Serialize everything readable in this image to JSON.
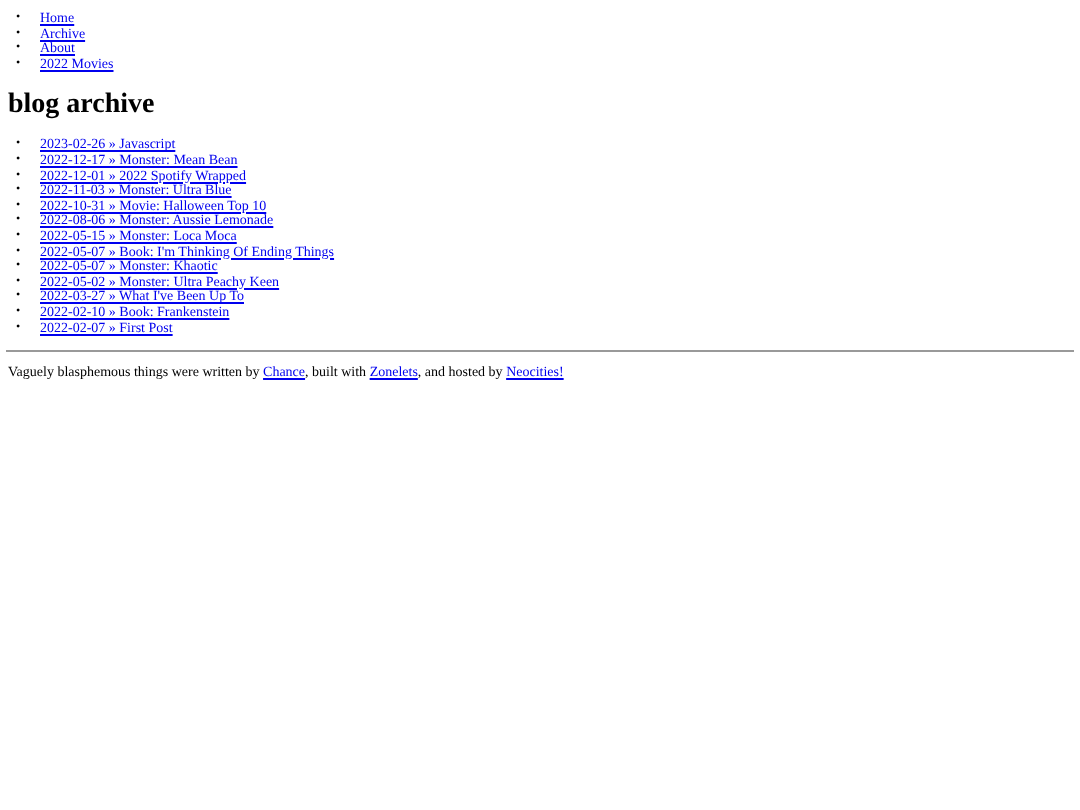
{
  "bullet": "•",
  "nav": [
    "Home",
    "Archive",
    "About",
    "2022 Movies"
  ],
  "heading": "blog archive",
  "posts": [
    "2023-02-26 » Javascript",
    "2022-12-17 » Monster: Mean Bean",
    "2022-12-01 » 2022 Spotify Wrapped",
    "2022-11-03 » Monster: Ultra Blue",
    "2022-10-31 » Movie: Halloween Top 10",
    "2022-08-06 » Monster: Aussie Lemonade",
    "2022-05-15 » Monster: Loca Moca",
    "2022-05-07 » Book: I'm Thinking Of Ending Things",
    "2022-05-07 » Monster: Khaotic",
    "2022-05-02 » Monster: Ultra Peachy Keen",
    "2022-03-27 » What I've Been Up To",
    "2022-02-10 » Book: Frankenstein",
    "2022-02-07 » First Post"
  ],
  "footer": [
    {
      "kind": "text",
      "text": "Vaguely blasphemous things were written by "
    },
    {
      "kind": "link",
      "text": "Chance"
    },
    {
      "kind": "text",
      "text": ", built with "
    },
    {
      "kind": "link",
      "text": "Zonelets"
    },
    {
      "kind": "text",
      "text": ", and hosted by "
    },
    {
      "kind": "link",
      "text": "Neocities!"
    }
  ]
}
